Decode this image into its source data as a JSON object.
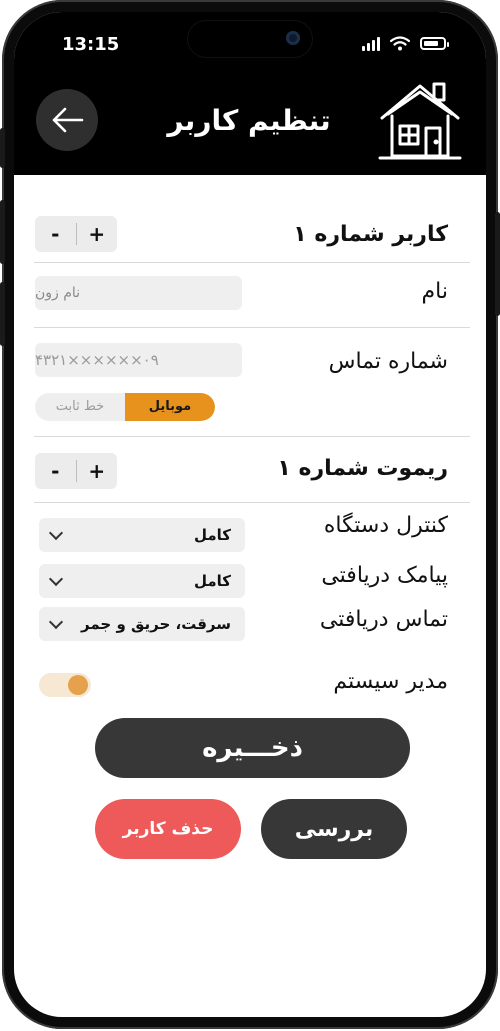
{
  "status_bar": {
    "time": "13:15"
  },
  "header": {
    "title": "تنظیم کاربر"
  },
  "user_row": {
    "label": "کاربر شماره ۱",
    "minus": "-",
    "plus": "+"
  },
  "name_row": {
    "label": "نام",
    "placeholder": "نام زون"
  },
  "phone_row": {
    "label": "شماره تماس",
    "value": "۰۹××××××۴۳۲۱",
    "options": {
      "mobile": "موبایل",
      "landline": "خط ثابت"
    },
    "selected": "موبایل"
  },
  "remote_row": {
    "label": "ریموت شماره ۱",
    "minus": "-",
    "plus": "+"
  },
  "device_control": {
    "label": "کنترل دستگاه",
    "value": "کامل"
  },
  "sms_received": {
    "label": "پیامک دریافتی",
    "value": "کامل"
  },
  "call_received": {
    "label": "تماس دریافتی",
    "value": "سرقت، حریق و جمر"
  },
  "system_admin": {
    "label": "مدیر سیستم",
    "enabled": true
  },
  "actions": {
    "save": "ذخـــیره",
    "check": "بررسی",
    "delete_user": "حذف کاربر"
  },
  "colors": {
    "accent": "#e8921e",
    "dark_button": "#373737",
    "danger": "#ee5a5a",
    "header_bg": "#000000"
  },
  "icons": {
    "back": "arrow-left-icon",
    "logo": "house-icon"
  }
}
